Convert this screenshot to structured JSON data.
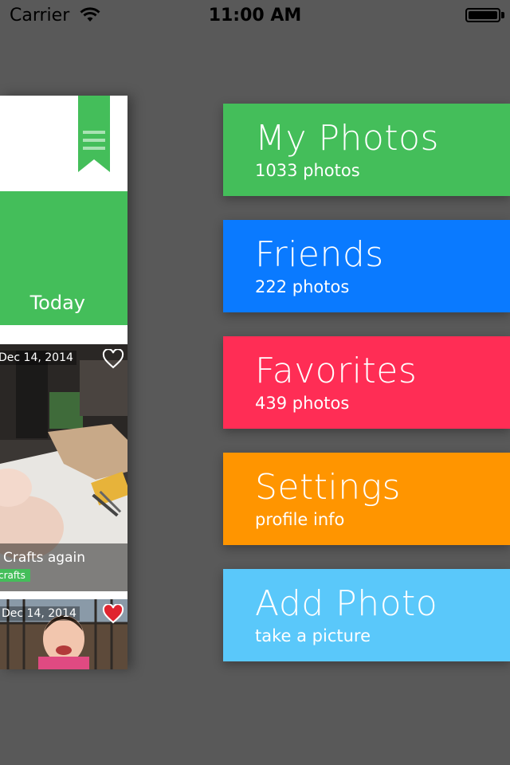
{
  "status_bar": {
    "carrier": "Carrier",
    "time": "11:00 AM"
  },
  "main_panel": {
    "banner_text": "Today",
    "banner_color": "#44be5a",
    "photos": [
      {
        "date": "Dec 14, 2014",
        "favorited": false,
        "caption": "Crafts again",
        "tag": "crafts"
      },
      {
        "date": "Dec 14, 2014",
        "favorited": true
      }
    ]
  },
  "menu": {
    "items": [
      {
        "title": "My Photos",
        "subtitle": "1033 photos",
        "color": "#44be5a"
      },
      {
        "title": "Friends",
        "subtitle": "222 photos",
        "color": "#0a7aff"
      },
      {
        "title": "Favorites",
        "subtitle": "439 photos",
        "color": "#ff2d55"
      },
      {
        "title": "Settings",
        "subtitle": "profile info",
        "color": "#ff9500"
      },
      {
        "title": "Add Photo",
        "subtitle": "take a picture",
        "color": "#5ac8fa"
      }
    ]
  }
}
